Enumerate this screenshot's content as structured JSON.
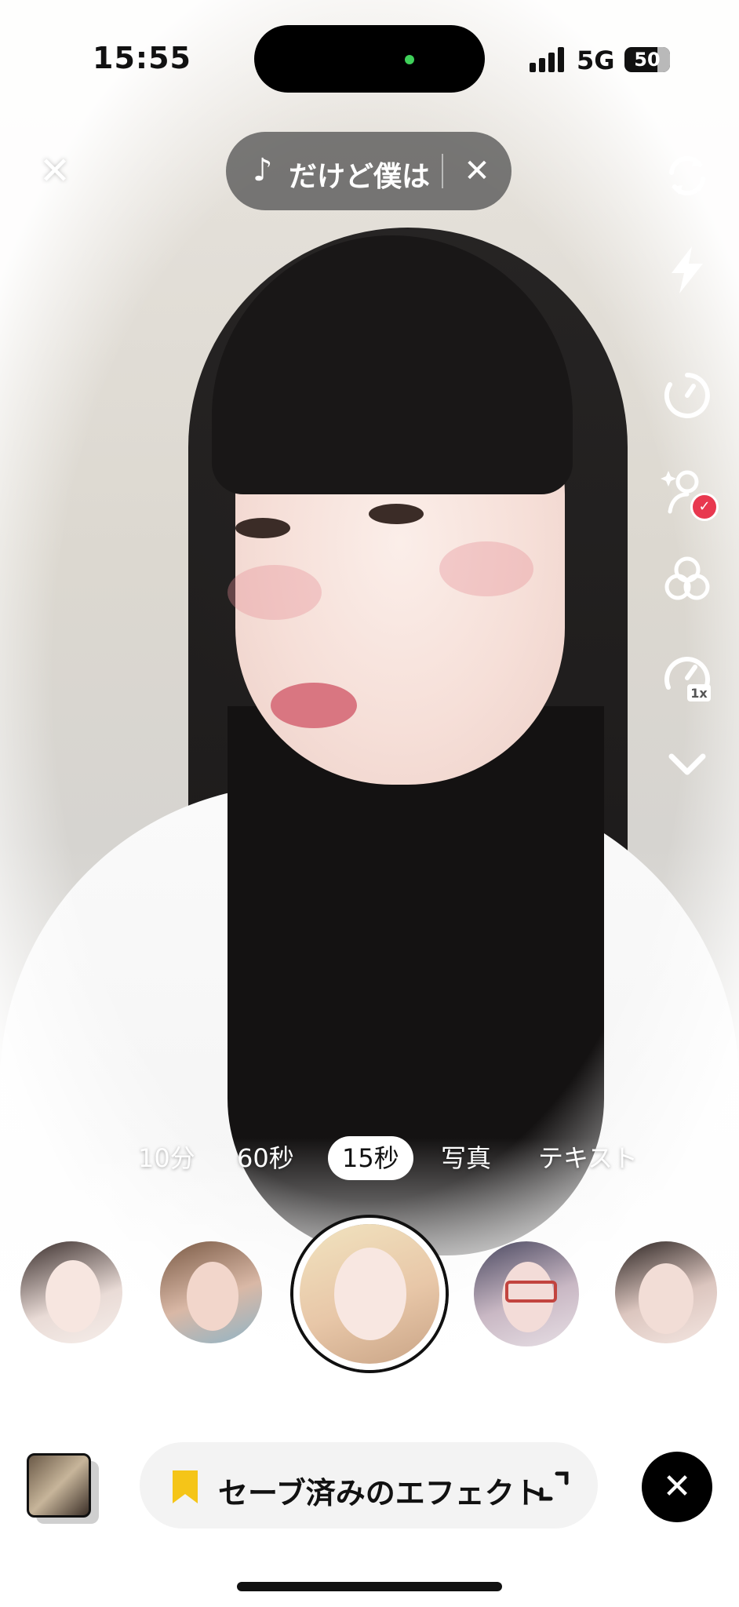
{
  "status_bar": {
    "time": "15:55",
    "network": "5G",
    "battery": "50"
  },
  "top_bar": {
    "close_symbol": "✕",
    "music": {
      "note_symbol": "♪",
      "title": "だけど僕は",
      "close_symbol": "✕"
    }
  },
  "right_toolbar": {
    "icons": [
      "flip-camera-icon",
      "flash-icon",
      "timer-icon",
      "beauty-icon",
      "filters-icon",
      "speed-icon",
      "more-chevron-icon"
    ],
    "beauty_badge": "✓",
    "speed_label": "1x"
  },
  "modes": {
    "items": [
      "10分",
      "60秒",
      "15秒",
      "写真",
      "テキスト"
    ],
    "active": "15秒"
  },
  "effects": {
    "selected_index": 2,
    "count": 5
  },
  "bottom_bar": {
    "saved_effects_label": "セーブ済みのエフェクト",
    "close_symbol": "✕"
  },
  "colors": {
    "badge": "#e8384f",
    "bookmark": "#f5c518",
    "status_green": "#3fd05a"
  }
}
